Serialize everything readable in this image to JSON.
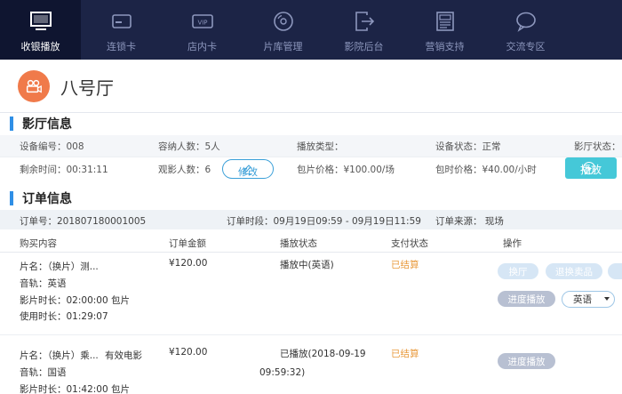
{
  "nav": {
    "items": [
      {
        "label": "收银播放",
        "icon": "monitor-icon",
        "active": true
      },
      {
        "label": "连锁卡",
        "icon": "card-icon"
      },
      {
        "label": "店内卡",
        "icon": "vip-card-icon"
      },
      {
        "label": "片库管理",
        "icon": "disc-icon"
      },
      {
        "label": "影院后台",
        "icon": "exit-icon"
      },
      {
        "label": "营销支持",
        "icon": "newspaper-icon"
      },
      {
        "label": "交流专区",
        "icon": "chat-icon"
      }
    ]
  },
  "hall": {
    "title": "八号厅",
    "icon": "camera-icon"
  },
  "hall_info": {
    "section_title": "影厅信息",
    "device_no": "设备编号：008",
    "capacity": "容纳人数：5人",
    "play_type": "播放类型：",
    "device_status": "设备状态：正常",
    "hall_status": "影厅状态：",
    "remaining": "剩余时间：00:31:11",
    "viewers": "观影人数：6",
    "edit_label": "修改",
    "package_price": "包片价格：¥100.00/场",
    "hourly_price": "包时价格：¥40.00/小时",
    "play_label": "播放"
  },
  "order": {
    "section_title": "订单信息",
    "order_no": "订单号：201807180001005",
    "order_period": "订单时段：09月19日09:59 - 09月19日11:59",
    "order_source": "订单来源： 现场",
    "columns": [
      "购买内容",
      "订单金额",
      "播放状态",
      "支付状态",
      "操作"
    ],
    "items": [
      {
        "film": "片名：（换片）测...",
        "track": "音轨：英语",
        "duration": "影片时长：02:00:00 包片",
        "used": "使用时长：01:29:07",
        "amount": "¥120.00",
        "play_status": "播放中(英语)",
        "pay_status": "已结算",
        "actions": [
          "换厅",
          "退换卖品"
        ],
        "progress_label": "进度播放",
        "lang": "英语"
      },
      {
        "film": "片名：（换片）乘...",
        "valid": "有效电影",
        "track": "音轨：国语",
        "duration": "影片时长：01:42:00 包片",
        "amount": "¥120.00",
        "play_status": "已播放(2018-09-19",
        "play_status_2": "09:59:32)",
        "pay_status": "已结算",
        "progress_label": "进度播放"
      }
    ]
  }
}
